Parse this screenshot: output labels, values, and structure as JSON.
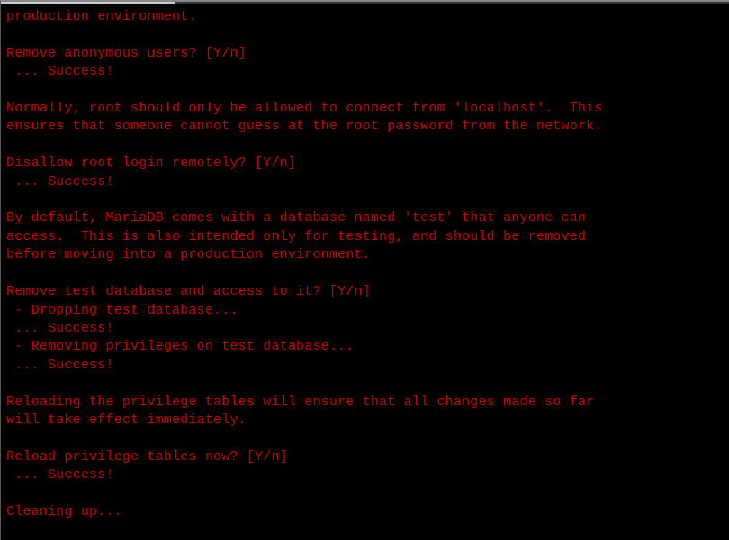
{
  "terminal": {
    "lines": [
      "production environment.",
      "",
      "Remove anonymous users? [Y/n]",
      " ... Success!",
      "",
      "Normally, root should only be allowed to connect from 'localhost'.  This",
      "ensures that someone cannot guess at the root password from the network.",
      "",
      "Disallow root login remotely? [Y/n]",
      " ... Success!",
      "",
      "By default, MariaDB comes with a database named 'test' that anyone can",
      "access.  This is also intended only for testing, and should be removed",
      "before moving into a production environment.",
      "",
      "Remove test database and access to it? [Y/n]",
      " - Dropping test database...",
      " ... Success!",
      " - Removing privileges on test database...",
      " ... Success!",
      "",
      "Reloading the privilege tables will ensure that all changes made so far",
      "will take effect immediately.",
      "",
      "Reload privilege tables now? [Y/n]",
      " ... Success!",
      "",
      "Cleaning up..."
    ]
  }
}
